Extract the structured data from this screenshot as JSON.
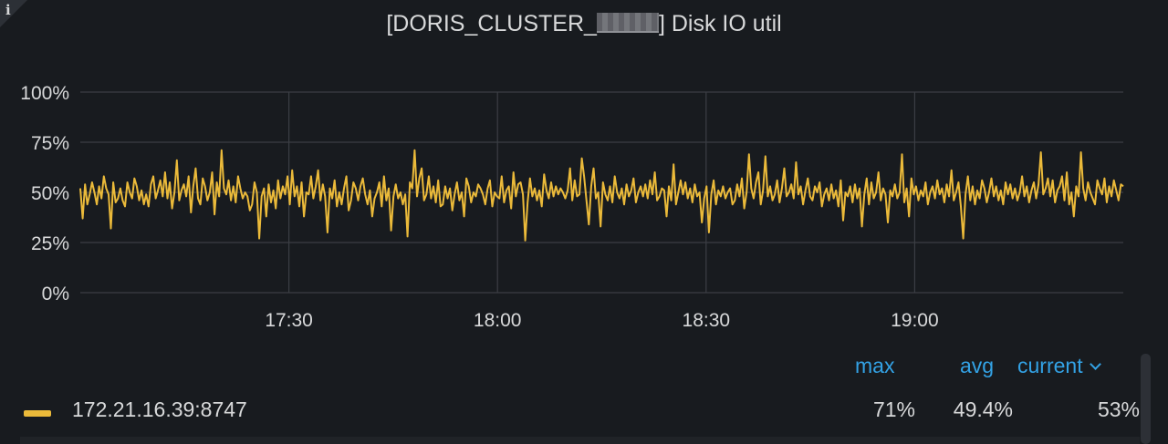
{
  "panel": {
    "info_icon": "info-icon",
    "title_prefix": "[DORIS_CLUSTER_",
    "title_suffix": "] Disk IO util"
  },
  "legend": {
    "headers": {
      "max": "max",
      "avg": "avg",
      "current": "current"
    },
    "sort_icon": "chevron-down-icon",
    "series": [
      {
        "name": "172.21.16.39:8747",
        "max": "71%",
        "avg": "49.4%",
        "current": "53%"
      }
    ]
  },
  "colors": {
    "series": "#ebba3a",
    "legend_header": "#33a2e5",
    "background": "#181b1f",
    "grid": "#3b3e44"
  },
  "chart_data": {
    "type": "line",
    "title": "",
    "y_ticks": [
      "100%",
      "75%",
      "50%",
      "25%",
      "0%"
    ],
    "x_ticks": [
      "17:30",
      "18:00",
      "18:30",
      "19:00"
    ],
    "ylim": [
      0,
      100
    ],
    "xlim": [
      "17:00",
      "19:30"
    ],
    "grid": true,
    "legend": "bottom",
    "series": [
      {
        "name": "172.21.16.39:8747",
        "color": "#ebba3a",
        "x_start": "17:00",
        "x_end": "19:30",
        "values": [
          52,
          37,
          54,
          44,
          49,
          55,
          50,
          44,
          53,
          47,
          58,
          52,
          49,
          32,
          55,
          45,
          47,
          52,
          46,
          43,
          55,
          50,
          47,
          57,
          53,
          46,
          51,
          44,
          49,
          43,
          54,
          58,
          47,
          51,
          56,
          48,
          60,
          47,
          55,
          42,
          50,
          66,
          46,
          51,
          54,
          48,
          58,
          40,
          53,
          62,
          47,
          44,
          57,
          53,
          46,
          50,
          60,
          39,
          55,
          48,
          71,
          52,
          49,
          56,
          46,
          53,
          45,
          58,
          52,
          47,
          50,
          48,
          41,
          44,
          55,
          50,
          27,
          48,
          52,
          38,
          54,
          45,
          51,
          42,
          56,
          47,
          53,
          49,
          58,
          44,
          61,
          48,
          53,
          43,
          55,
          38,
          50,
          49,
          58,
          47,
          53,
          61,
          46,
          54,
          48,
          30,
          52,
          47,
          56,
          43,
          50,
          44,
          52,
          58,
          41,
          46,
          55,
          52,
          46,
          53,
          57,
          49,
          44,
          51,
          38,
          47,
          50,
          55,
          43,
          58,
          46,
          52,
          31,
          48,
          54,
          47,
          50,
          44,
          49,
          28,
          55,
          52,
          71,
          48,
          57,
          62,
          46,
          49,
          58,
          47,
          53,
          45,
          56,
          43,
          44,
          53,
          47,
          52,
          41,
          49,
          55,
          46,
          50,
          38,
          57,
          53,
          45,
          50,
          48,
          54,
          52,
          49,
          44,
          52,
          56,
          43,
          50,
          48,
          47,
          58,
          45,
          51,
          53,
          42,
          60,
          48,
          54,
          55,
          49,
          26,
          45,
          57,
          48,
          52,
          46,
          51,
          43,
          59,
          51,
          47,
          55,
          48,
          53,
          49,
          52,
          50,
          47,
          51,
          62,
          46,
          56,
          48,
          49,
          67,
          58,
          46,
          34,
          53,
          62,
          47,
          50,
          33,
          55,
          49,
          46,
          53,
          45,
          58,
          50,
          47,
          52,
          44,
          54,
          48,
          51,
          57,
          45,
          50,
          53,
          48,
          54,
          47,
          56,
          49,
          60,
          46,
          48,
          52,
          51,
          38,
          53,
          46,
          64,
          44,
          50,
          56,
          49,
          55,
          47,
          52,
          45,
          54,
          48,
          50,
          35,
          47,
          53,
          30,
          49,
          56,
          44,
          51,
          48,
          53,
          47,
          50,
          52,
          44,
          46,
          54,
          48,
          57,
          42,
          50,
          69,
          52,
          47,
          55,
          60,
          44,
          51,
          68,
          48,
          53,
          46,
          49,
          56,
          45,
          52,
          62,
          48,
          50,
          54,
          47,
          65,
          49,
          53,
          44,
          51,
          57,
          48,
          46,
          53,
          50,
          55,
          43,
          49,
          52,
          46,
          54,
          47,
          51,
          43,
          56,
          36,
          50,
          48,
          53,
          45,
          54,
          47,
          52,
          33,
          49,
          57,
          44,
          55,
          47,
          50,
          60,
          46,
          52,
          49,
          35,
          51,
          48,
          54,
          47,
          50,
          69,
          45,
          52,
          38,
          57,
          49,
          53,
          46,
          51,
          48,
          55,
          44,
          50,
          53,
          47,
          56,
          49,
          52,
          45,
          54,
          48,
          61,
          46,
          50,
          55,
          43,
          27,
          49,
          58,
          46,
          53,
          44,
          51,
          47,
          56,
          52,
          45,
          50,
          57,
          48,
          53,
          46,
          51,
          44,
          55,
          49,
          54,
          47,
          52,
          46,
          50,
          58,
          48,
          53,
          45,
          51,
          55,
          47,
          54,
          70,
          49,
          52,
          57,
          48,
          56,
          45,
          51,
          53,
          58,
          46,
          60,
          44,
          50,
          38,
          53,
          48,
          70,
          52,
          46,
          55,
          50,
          47,
          44,
          56,
          52,
          49,
          57,
          45,
          53,
          48,
          56,
          51,
          46,
          54,
          53
        ]
      }
    ]
  }
}
